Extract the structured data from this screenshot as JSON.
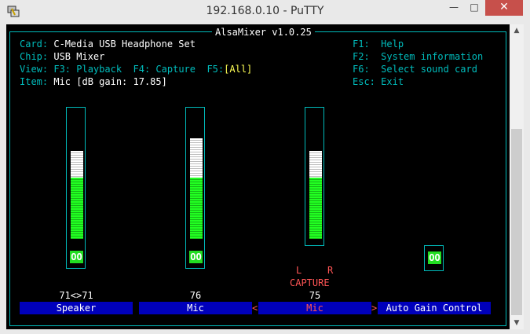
{
  "window": {
    "title": "192.168.0.10 - PuTTY",
    "minimize_glyph": "—",
    "maximize_glyph": "□",
    "close_glyph": "✕"
  },
  "header": {
    "title": "AlsaMixer v1.0.25",
    "card_label": "Card:",
    "card_value": "C-Media USB Headphone Set",
    "chip_label": "Chip:",
    "chip_value": "USB Mixer",
    "view_label": "View:",
    "view_playback": "F3: Playback",
    "view_capture": "F4: Capture",
    "view_all_key": "F5:",
    "view_all": "[All]",
    "item_label": "Item:",
    "item_value": "Mic [dB gain: 17.85]"
  },
  "help": [
    {
      "key": "F1:",
      "text": "Help"
    },
    {
      "key": "F2:",
      "text": "System information"
    },
    {
      "key": "F6:",
      "text": "Select sound card"
    },
    {
      "key": "Esc:",
      "text": "Exit"
    }
  ],
  "controls": [
    {
      "name": "Speaker",
      "value_text": "71<>71",
      "level": 0.71,
      "switch": "OO",
      "selected": false
    },
    {
      "name": "Mic",
      "value_text": "76",
      "level": 0.76,
      "switch": "OO",
      "selected": false
    },
    {
      "name": "Mic",
      "value_text": "75",
      "level": 0.75,
      "switch": "",
      "capture_l": "L",
      "capture_r": "R",
      "capture_label": "CAPTURE",
      "selected": true,
      "sel_left": "<",
      "sel_right": ">"
    },
    {
      "name": "Auto Gain Control",
      "value_text": "",
      "switch": "OO",
      "selected": false
    }
  ],
  "colors": {
    "terminal_bg": "#000000",
    "cyan": "#00bbbb",
    "label_bg": "#0000bb",
    "green": "#22ff22",
    "capture_red": "#ff5555",
    "close_button": "#c7504b"
  }
}
